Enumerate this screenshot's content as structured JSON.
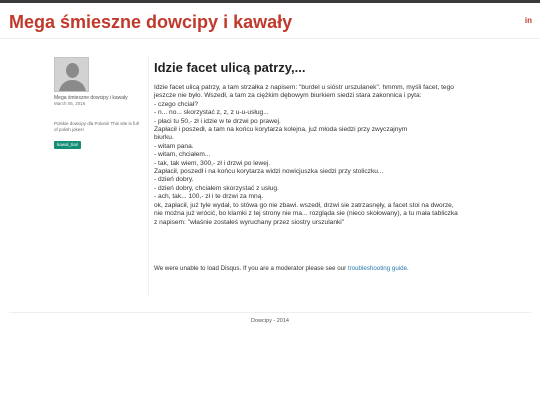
{
  "header": {
    "site_title": "Mega śmieszne dowcipy i kawały",
    "social_icon_label": "in"
  },
  "sidebar": {
    "author_name": "Mega śmieszne dowcipy i kawały",
    "post_date": "March 05, 2016",
    "site_description": "Polskie dowcipy dla Polonii! This site is full of polish jokes!",
    "tag": "kawal_tiari"
  },
  "article": {
    "title": "Idzie facet ulicą patrzy,...",
    "lines": [
      "Idzie facet ulicą patrzy, a tam strzałka z napisem: \"burdel u sióstr urszulanek\". hmmm, myśli facet, tego",
      "jeszcze nie było. Wszedł, a tam za ciężkim dębowym biurkiem siedzi stara zakonnica i pyta:",
      "- czego chciał?",
      "- n... no... skorzystać z, z, z u-u-usług...",
      "- płaci tu 50,- zł i idzie w te drzwi po prawej.",
      "Zapłacił i poszedł, a tam na końcu korytarza kolejna, już młoda siedzi przy zwyczajnym",
      "biurku.",
      "- witam pana.",
      "- witam, chciałem...",
      "- tak, tak wiem, 300,- zł i drzwi po lewej.",
      "Zapłacił, poszedł i na końcu korytarza widzi nowicjuszka siedzi przy stoliczku...",
      "- dzień dobry.",
      "- dzień dobry, chciałem skorzystać z usług.",
      "- ach, tak... 100,- zł i te drzwi za mną.",
      "ok, zapłacił, już tyle wydał, to stówa go nie zbawi. wszedł, drzwi sie zatrzasnęły, a facet stoi na dworze,",
      "nie można już wrócić, bo klamki z tej strony nie ma... rozgląda sie (nieco skołowany), a tu mała tabliczka",
      "z napisem: \"właśnie zostałeś wyruchany przez siostry urszulanki\""
    ]
  },
  "comments": {
    "disqus_message": "We were unable to load Disqus. If you are a moderator please see our ",
    "disqus_link": "troubleshooting guide",
    "disqus_suffix": "."
  },
  "footer": {
    "text": "Dowcipy - 2014"
  }
}
